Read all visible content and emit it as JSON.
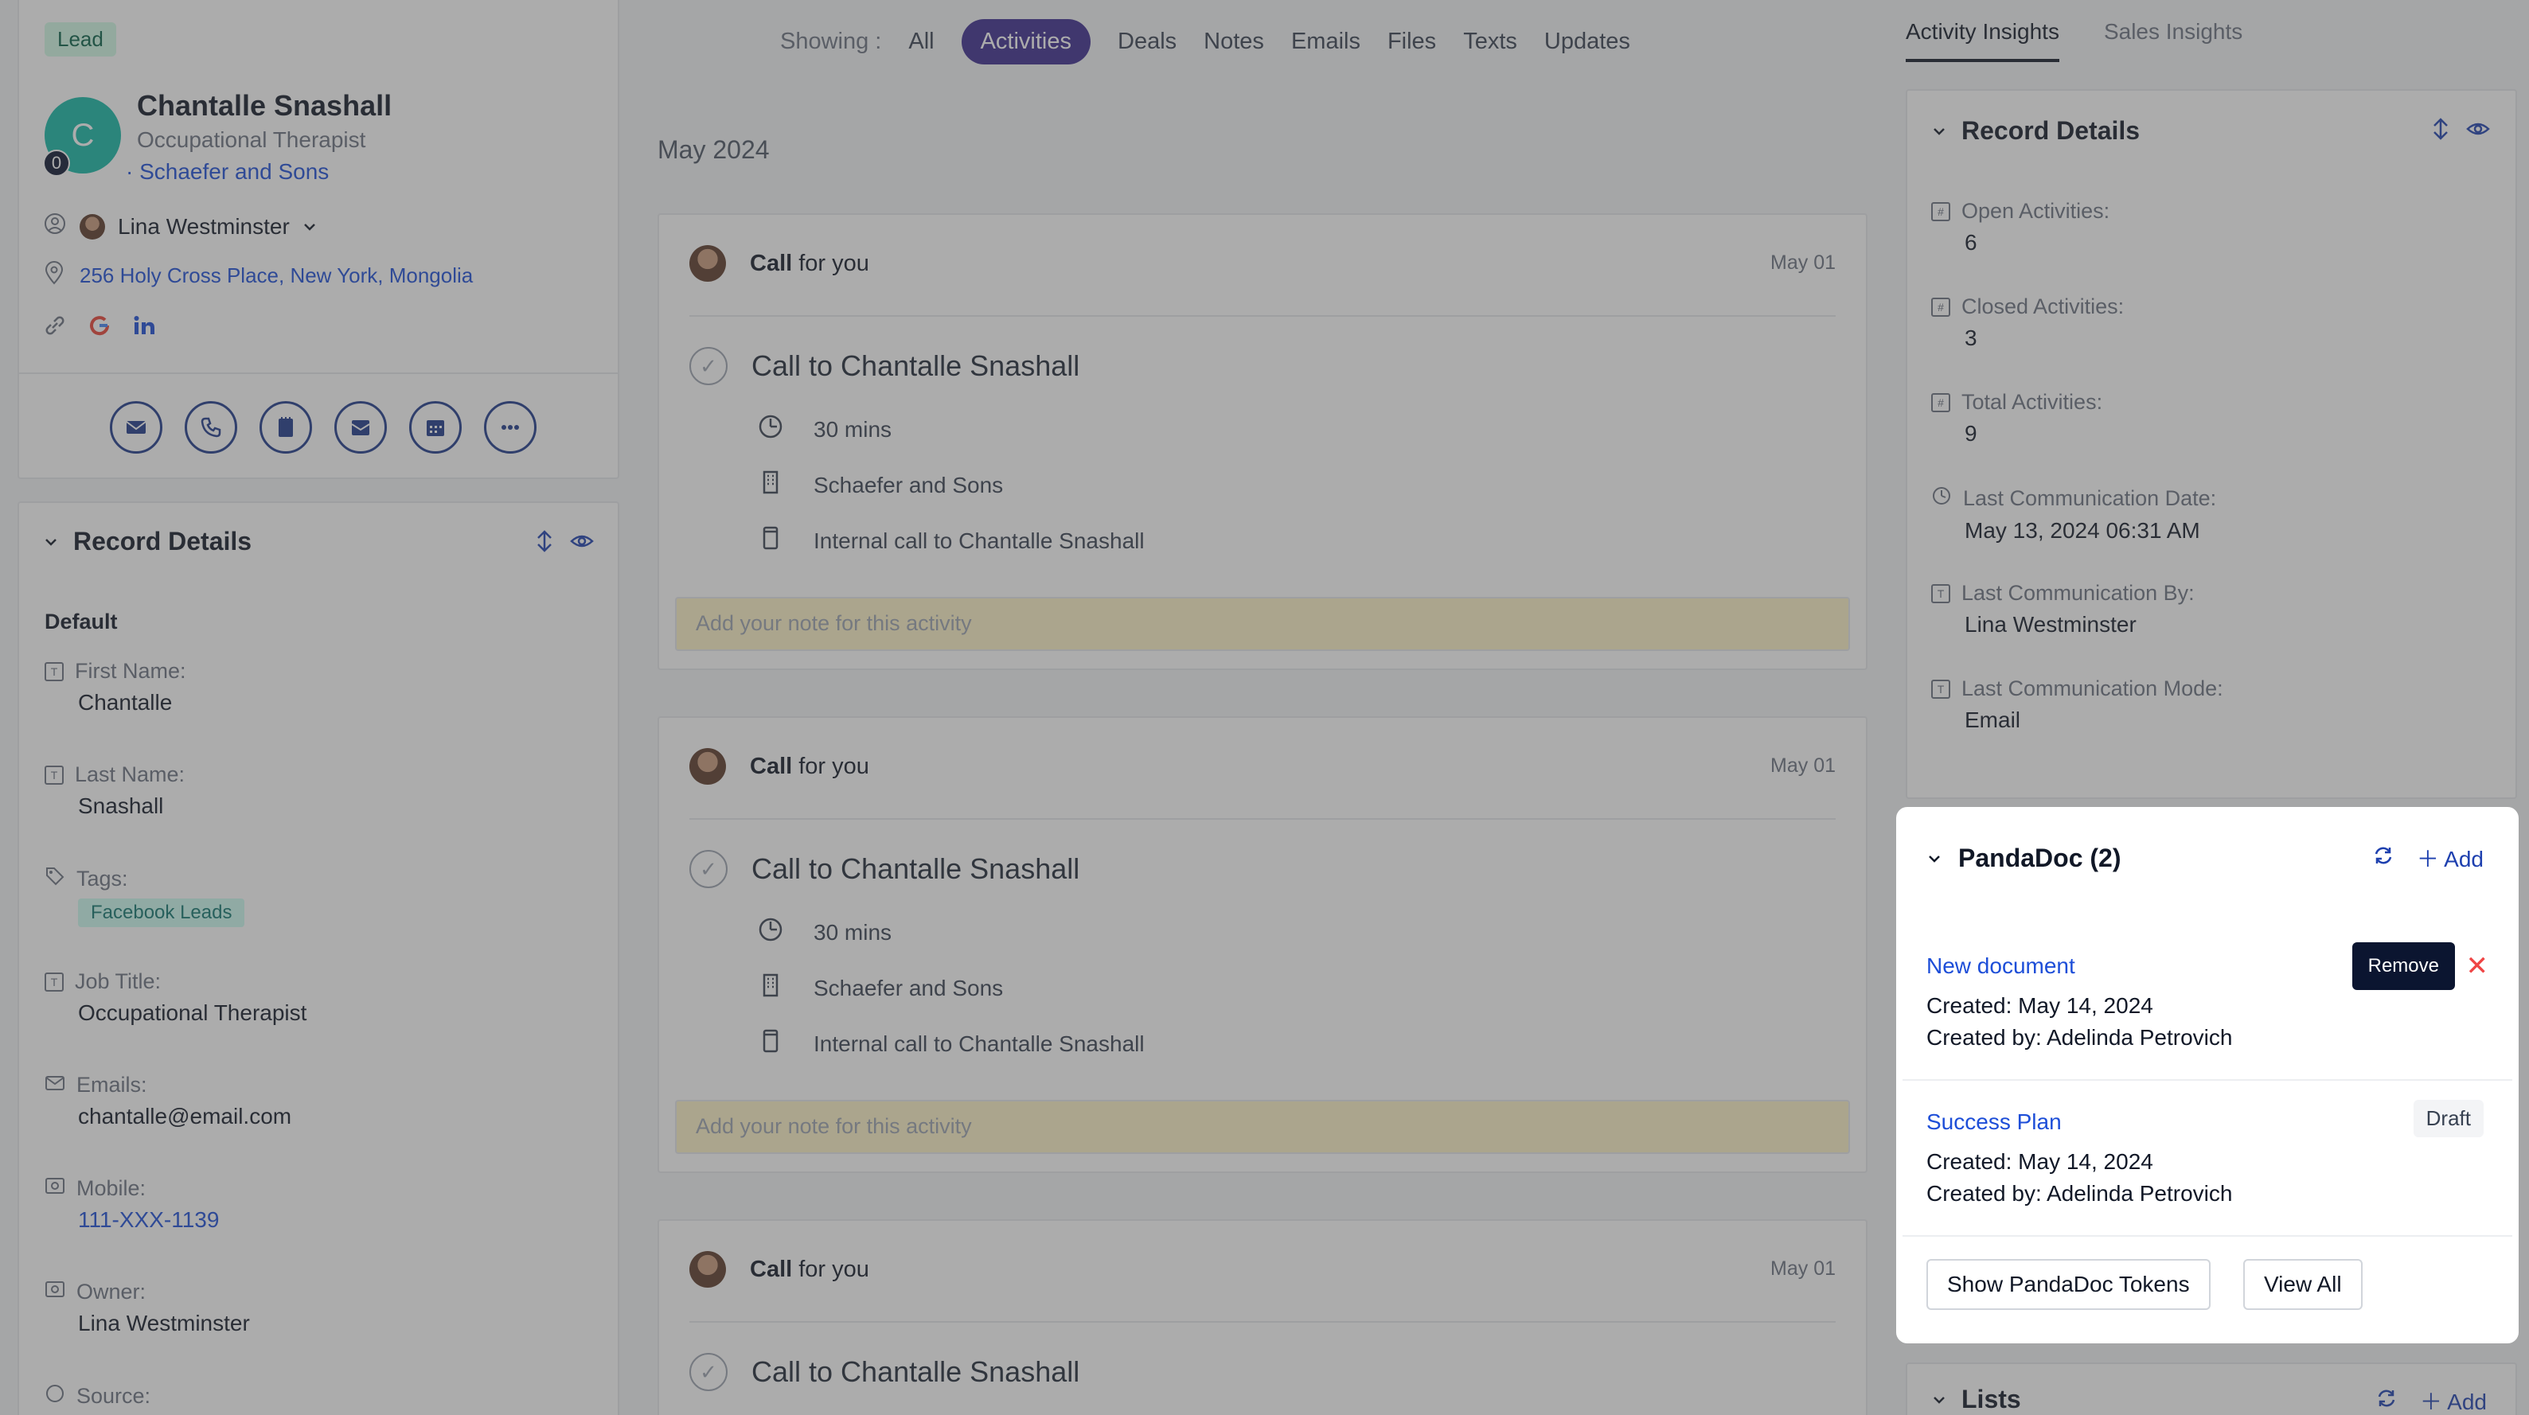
{
  "profile": {
    "tag": "Lead",
    "avatar_initial": "C",
    "avatar_badge": "0",
    "name": "Chantalle Snashall",
    "job_title": "Occupational Therapist",
    "company": "· Schaefer and Sons",
    "owner": "Lina Westminster",
    "address": "256 Holy Cross Place, New York, Mongolia"
  },
  "left_record_details": {
    "title": "Record Details",
    "group": "Default",
    "fields": [
      {
        "label": "First Name:",
        "value": "Chantalle"
      },
      {
        "label": "Last Name:",
        "value": "Snashall"
      },
      {
        "label": "Tags:",
        "value": "Facebook Leads"
      },
      {
        "label": "Job Title:",
        "value": "Occupational Therapist"
      },
      {
        "label": "Emails:",
        "value": "chantalle@email.com"
      },
      {
        "label": "Mobile:",
        "value": "111-XXX-1139"
      },
      {
        "label": "Owner:",
        "value": "Lina Westminster"
      },
      {
        "label": "Source:",
        "value": ""
      }
    ]
  },
  "filters": {
    "showing_label": "Showing :",
    "items": [
      "All",
      "Activities",
      "Deals",
      "Notes",
      "Emails",
      "Files",
      "Texts",
      "Updates"
    ],
    "active": "Activities"
  },
  "timeline": {
    "month": "May 2024",
    "activities": [
      {
        "type": "Call",
        "for": "for you",
        "date": "May 01",
        "title": "Call to Chantalle Snashall",
        "duration": "30 mins",
        "company": "Schaefer and Sons",
        "description": "Internal call to Chantalle Snashall",
        "note_placeholder": "Add your note for this activity"
      },
      {
        "type": "Call",
        "for": "for you",
        "date": "May 01",
        "title": "Call to Chantalle Snashall",
        "duration": "30 mins",
        "company": "Schaefer and Sons",
        "description": "Internal call to Chantalle Snashall",
        "note_placeholder": "Add your note for this activity"
      },
      {
        "type": "Call",
        "for": "for you",
        "date": "May 01",
        "title": "Call to Chantalle Snashall"
      }
    ]
  },
  "right_tabs": [
    "Activity Insights",
    "Sales Insights"
  ],
  "right_record_details": {
    "title": "Record Details",
    "fields": [
      {
        "label": "Open Activities:",
        "value": "6"
      },
      {
        "label": "Closed Activities:",
        "value": "3"
      },
      {
        "label": "Total Activities:",
        "value": "9"
      },
      {
        "label": "Last Communication Date:",
        "value": "May 13, 2024 06:31 AM"
      },
      {
        "label": "Last Communication By:",
        "value": "Lina Westminster"
      },
      {
        "label": "Last Communication Mode:",
        "value": "Email"
      }
    ]
  },
  "pandadoc": {
    "title": "PandaDoc (2)",
    "add_label": "Add",
    "remove_label": "Remove",
    "documents": [
      {
        "name": "New document",
        "created": "Created: May 14, 2024",
        "created_by": "Created by: Adelinda Petrovich"
      },
      {
        "name": "Success Plan",
        "status": "Draft",
        "created": "Created: May 14, 2024",
        "created_by": "Created by: Adelinda Petrovich"
      }
    ],
    "show_tokens_label": "Show PandaDoc Tokens",
    "view_all_label": "View All"
  },
  "lists": {
    "title": "Lists",
    "add_label": "Add"
  }
}
